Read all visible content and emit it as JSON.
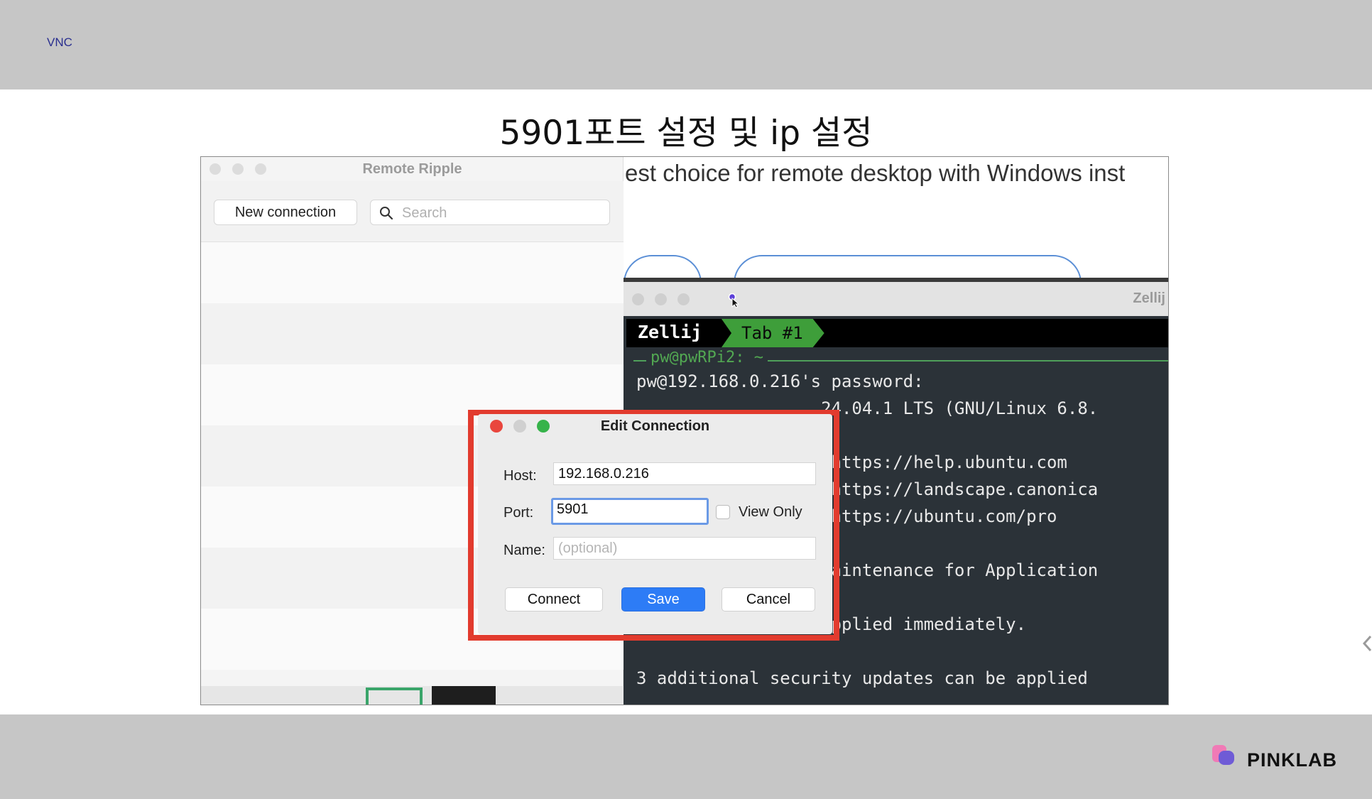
{
  "header": {
    "vnc_label": "VNC"
  },
  "slide": {
    "title": "5901포트 설정 및 ip 설정",
    "behind_text": "est choice for remote desktop with Windows inst"
  },
  "remote_ripple": {
    "title": "Remote Ripple",
    "new_connection_label": "New connection",
    "search_placeholder": "Search"
  },
  "zellij": {
    "window_title": "Zellij",
    "tab_app": "Zellij",
    "tab_name": "Tab #1",
    "pane_title": "pw@pwRPi2: ~",
    "lines": [
      "pw@192.168.0.216's password:",
      "                  24.04.1 LTS (GNU/Linux 6.8.",
      "",
      "                   https://help.ubuntu.com",
      "                   https://landscape.canonica",
      "                   https://ubuntu.com/pro",
      "",
      "                  Maintenance for Application",
      "",
      "                  applied immediately.",
      "",
      "3 additional security updates can be applied"
    ]
  },
  "dialog": {
    "title": "Edit Connection",
    "host_label": "Host:",
    "host_value": "192.168.0.216",
    "port_label": "Port:",
    "port_value": "5901",
    "view_only_label": "View Only",
    "name_label": "Name:",
    "name_placeholder": "(optional)",
    "connect_label": "Connect",
    "save_label": "Save",
    "cancel_label": "Cancel"
  },
  "footer": {
    "brand": "PINKLAB"
  },
  "colors": {
    "highlight": "#e23b2e",
    "save_button": "#2d7cf6",
    "tab_active": "#3e9e3a",
    "terminal_bg": "#2b3238"
  }
}
